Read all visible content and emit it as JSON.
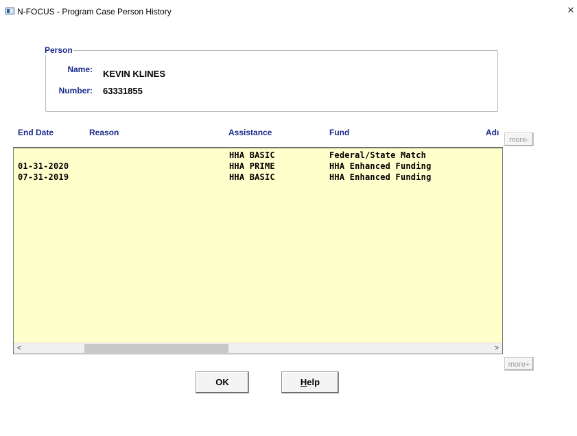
{
  "window": {
    "title": "N-FOCUS - Program Case Person History",
    "close_glyph": "×"
  },
  "person": {
    "legend": "Person",
    "name_label": "Name:",
    "name_value": "KEVIN KLINES",
    "number_label": "Number:",
    "number_value": "63331855"
  },
  "grid": {
    "columns": [
      "End Date",
      "Reason",
      "Assistance",
      "Fund",
      "Adı"
    ],
    "rows": [
      {
        "end_date": "",
        "reason": "",
        "assistance": "HHA BASIC",
        "fund": "Federal/State Match"
      },
      {
        "end_date": "01-31-2020",
        "reason": "",
        "assistance": "HHA PRIME",
        "fund": "HHA Enhanced Funding"
      },
      {
        "end_date": "07-31-2019",
        "reason": "",
        "assistance": "HHA BASIC",
        "fund": "HHA Enhanced Funding"
      }
    ],
    "scroll_left_glyph": "<",
    "scroll_right_glyph": ">",
    "background_color": "#ffffcc"
  },
  "buttons": {
    "more_up": "more-",
    "more_down": "more+",
    "ok": "OK",
    "help_mnemonic": "H",
    "help_rest": "elp"
  },
  "colors": {
    "label_blue": "#1a2a8c"
  }
}
